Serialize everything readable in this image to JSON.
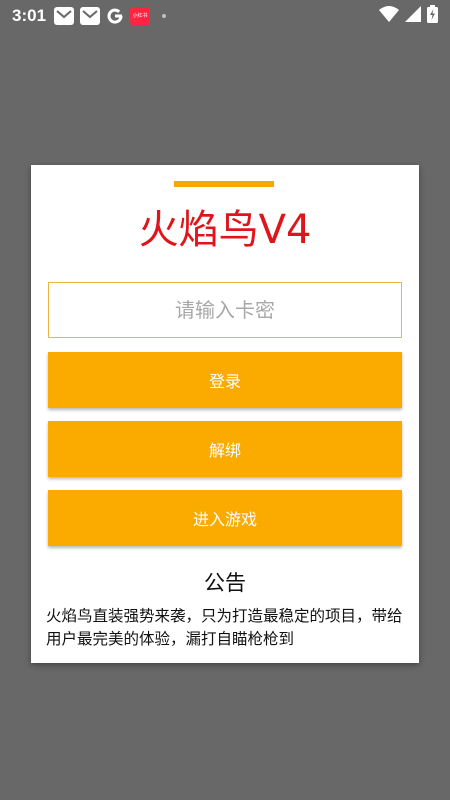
{
  "status_bar": {
    "time": "3:01",
    "notification_icons": [
      "mail-icon",
      "mail-icon",
      "google-icon",
      "xiaohongshu-icon"
    ],
    "xiaohongshu_badge": "小红书",
    "status_icons": [
      "wifi-icon",
      "signal-icon",
      "battery-icon"
    ]
  },
  "dialog": {
    "title": "火焰鸟V4",
    "key_input": {
      "placeholder": "请输入卡密",
      "value": ""
    },
    "buttons": {
      "login": "登录",
      "unbind": "解绑",
      "enter_game": "进入游戏"
    },
    "notice": {
      "title": "公告",
      "body": "火焰鸟直装强势来袭，只为打造最稳定的项目，带给用户最完美的体验，漏打自瞄枪枪到"
    }
  },
  "colors": {
    "accent": "#fbab00",
    "title_red": "#e0141b",
    "overlay": "#686868"
  }
}
